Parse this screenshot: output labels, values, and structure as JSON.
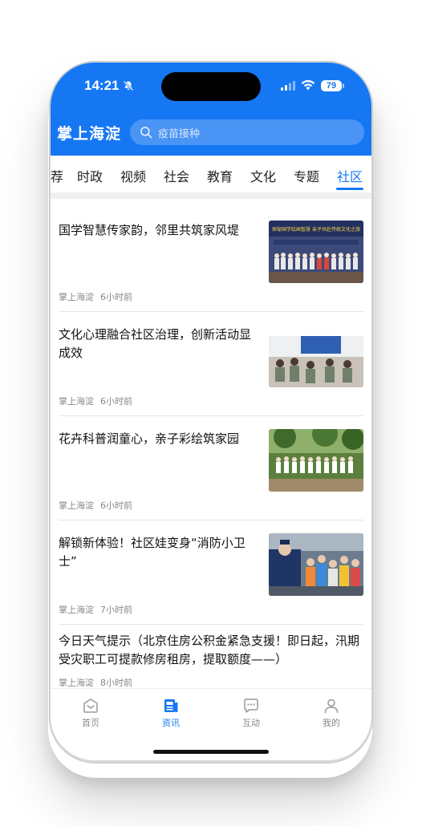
{
  "status_bar": {
    "time": "14:21",
    "battery": "79"
  },
  "header": {
    "app_title": "掌上海淀",
    "search_placeholder": "疫苗接种"
  },
  "tabs": [
    {
      "label": "荐"
    },
    {
      "label": "时政"
    },
    {
      "label": "视频"
    },
    {
      "label": "社会"
    },
    {
      "label": "教育"
    },
    {
      "label": "文化"
    },
    {
      "label": "专题"
    },
    {
      "label": "社区",
      "active": true
    }
  ],
  "news": [
    {
      "title": "国学智慧传家韵，邻里共筑家风堤",
      "source": "掌上海淀",
      "time_ago": "6小时前",
      "thumb_banner_text": "探秘国学绘画智慧 亲子共赴传统文化之旅"
    },
    {
      "title": "文化心理融合社区治理，创新活动显成效",
      "source": "掌上海淀",
      "time_ago": "6小时前"
    },
    {
      "title": "花卉科普润童心，亲子彩绘筑家园",
      "source": "掌上海淀",
      "time_ago": "6小时前"
    },
    {
      "title": "解锁新体验！社区娃变身“消防小卫士”",
      "source": "掌上海淀",
      "time_ago": "7小时前"
    },
    {
      "title": "今日天气提示（北京住房公积金紧急支援！即日起，汛期受灾职工可提款修房租房，提取额度——）",
      "source": "掌上海淀",
      "time_ago": "8小时前"
    }
  ],
  "bottom_nav": [
    {
      "label": "首页",
      "icon": "home-icon"
    },
    {
      "label": "资讯",
      "icon": "news-icon",
      "active": true
    },
    {
      "label": "互动",
      "icon": "chat-icon"
    },
    {
      "label": "我的",
      "icon": "profile-icon"
    }
  ],
  "colors": {
    "brand": "#1677f3",
    "text": "#111111",
    "meta": "#888888"
  }
}
